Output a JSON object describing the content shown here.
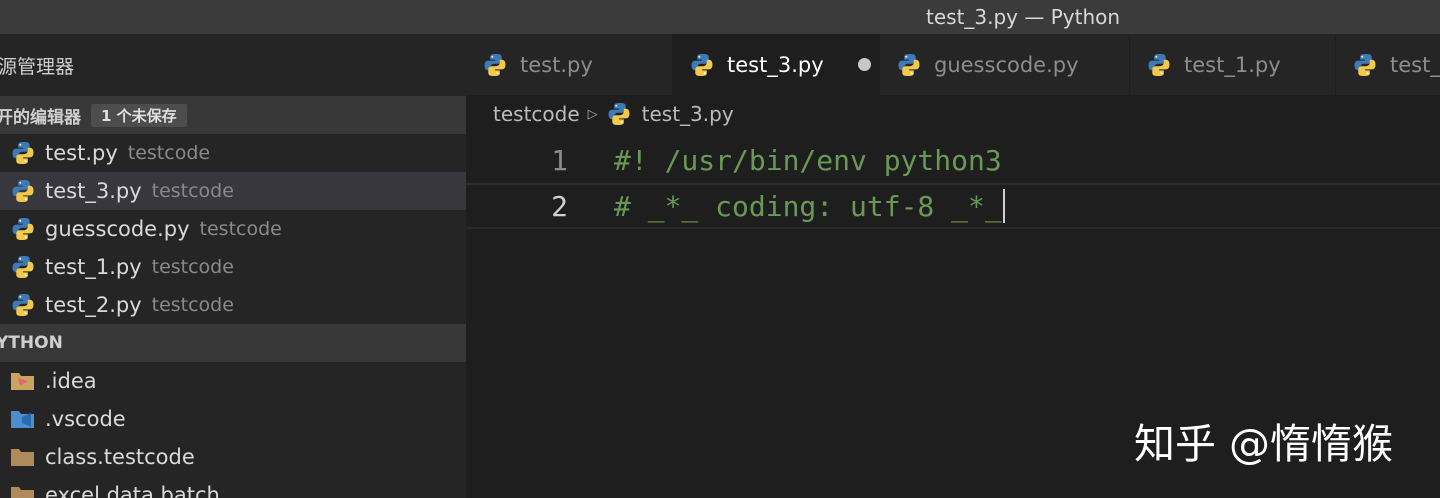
{
  "window": {
    "title": "test_3.py — Python"
  },
  "sidebar": {
    "header": "源管理器",
    "open_editors": {
      "label": "开的编辑器",
      "badge": "1 个未保存",
      "items": [
        {
          "name": "test.py",
          "desc": "testcode"
        },
        {
          "name": "test_3.py",
          "desc": "testcode"
        },
        {
          "name": "guesscode.py",
          "desc": "testcode"
        },
        {
          "name": "test_1.py",
          "desc": "testcode"
        },
        {
          "name": "test_2.py",
          "desc": "testcode"
        }
      ]
    },
    "workspace": {
      "label": "YTHON",
      "items": [
        {
          "name": ".idea",
          "icon": "idea-folder-icon"
        },
        {
          "name": ".vscode",
          "icon": "vscode-folder-icon"
        },
        {
          "name": "class.testcode",
          "icon": "folder-icon"
        },
        {
          "name": "excel data batch",
          "icon": "folder-icon"
        }
      ]
    }
  },
  "tabs": [
    {
      "label": "test.py"
    },
    {
      "label": "test_3.py",
      "active": true,
      "unsaved": true
    },
    {
      "label": "guesscode.py"
    },
    {
      "label": "test_1.py"
    },
    {
      "label": "test_"
    }
  ],
  "breadcrumb": {
    "folder": "testcode",
    "file": "test_3.py"
  },
  "code": {
    "lines": [
      {
        "num": "1",
        "text": "#! /usr/bin/env python3"
      },
      {
        "num": "2",
        "text": "# _*_ coding: utf-8 _*_"
      }
    ]
  },
  "watermark": "知乎 @惰惰猴",
  "colors": {
    "comment": "#6a9955",
    "sidebar_bg": "#252526",
    "editor_bg": "#1e1e1e"
  }
}
